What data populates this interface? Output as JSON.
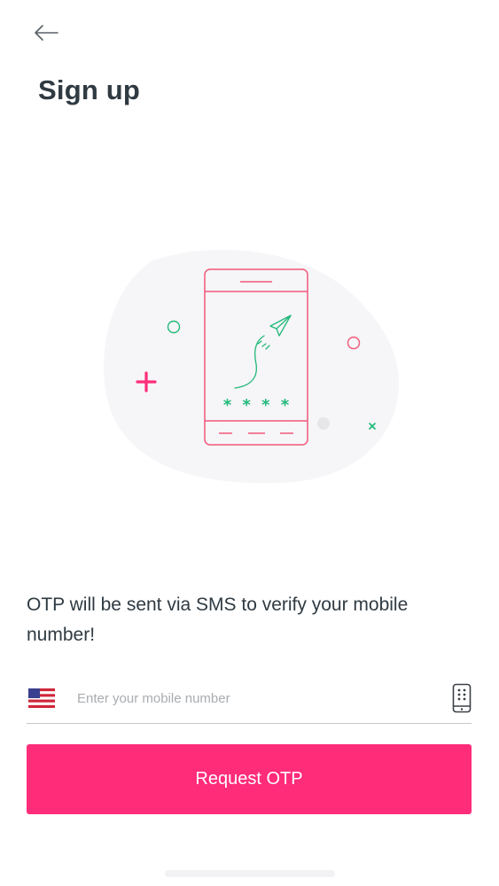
{
  "header": {
    "back_icon": "arrow-left-icon",
    "title": "Sign up"
  },
  "illustration": {
    "icon": "phone-sms-otp-illustration",
    "otp_mask": "* * * *",
    "colors": {
      "phone_outline": "#f0587a",
      "accent_green": "#21b97a",
      "accent_pink": "#ff2c7a",
      "blob": "#f6f5f7"
    }
  },
  "message": {
    "text": "OTP will be sent via SMS to verify your mobile number!"
  },
  "phone_input": {
    "country_flag": "us-flag-icon",
    "value": "",
    "placeholder": "Enter your mobile number",
    "trailing_icon": "mobile-device-icon"
  },
  "actions": {
    "request_otp_label": "Request OTP"
  },
  "colors": {
    "primary": "#ff2c7a",
    "text": "#2f3a42",
    "divider": "#c8c8cc",
    "placeholder": "#a9acb0"
  }
}
